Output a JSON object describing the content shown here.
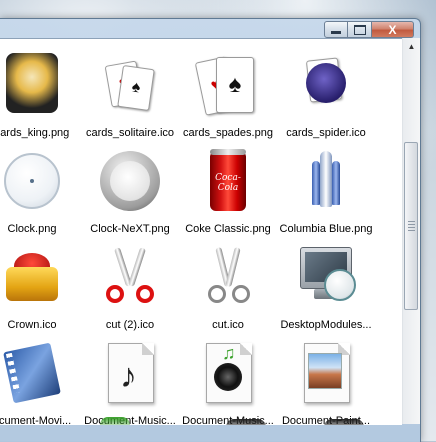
{
  "window": {
    "controls": {
      "minimize_icon": "minimize-icon",
      "maximize_icon": "maximize-icon",
      "close_label": "X"
    }
  },
  "files": [
    {
      "name": "cards_king.png",
      "icon": "cards-king-icon"
    },
    {
      "name": "cards_solitaire.ico",
      "icon": "cards-solitaire-icon"
    },
    {
      "name": "cards_spades.png",
      "icon": "cards-spades-icon"
    },
    {
      "name": "cards_spider.ico",
      "icon": "cards-spider-icon"
    },
    {
      "name": "Clock.png",
      "icon": "clock-icon"
    },
    {
      "name": "Clock-NeXT.png",
      "icon": "clock-next-icon"
    },
    {
      "name": "Coke Classic.png",
      "icon": "coke-can-icon",
      "can_text": "Coca-Cola"
    },
    {
      "name": "Columbia Blue.png",
      "icon": "space-shuttle-icon"
    },
    {
      "name": "Crown.ico",
      "icon": "crown-icon"
    },
    {
      "name": "cut (2).ico",
      "icon": "red-scissors-icon"
    },
    {
      "name": "cut.ico",
      "icon": "gray-scissors-icon"
    },
    {
      "name": "DesktopModules...",
      "icon": "desktop-clock-icon"
    },
    {
      "name": "ocument-Movi...",
      "icon": "document-movie-icon"
    },
    {
      "name": "Document-Music...",
      "icon": "document-music-note-icon"
    },
    {
      "name": "Document-Music...",
      "icon": "document-music-speaker-icon"
    },
    {
      "name": "Document-Paint...",
      "icon": "document-paint-icon"
    }
  ],
  "colors": {
    "selection_accent": "#5f7a94",
    "close_button": "#c25a3f",
    "content_bg": "#ffffff"
  }
}
